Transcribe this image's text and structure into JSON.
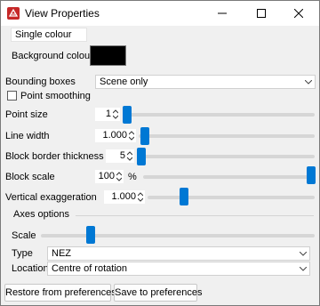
{
  "window": {
    "title": "View Properties"
  },
  "display": {
    "mode_label": "Single colour",
    "background_label": "Background colour",
    "background_color": "#000000"
  },
  "bounding_boxes": {
    "label": "Bounding boxes",
    "value": "Scene only"
  },
  "point_smoothing": {
    "label": "Point smoothing",
    "checked": false
  },
  "point_size": {
    "label": "Point size",
    "value": "1",
    "slider": 0.0
  },
  "line_width": {
    "label": "Line width",
    "value": "1.000",
    "slider": 0.05
  },
  "block_border": {
    "label": "Block border thickness",
    "value": "5",
    "slider": 0.0
  },
  "block_scale": {
    "label": "Block scale",
    "value": "100",
    "unit": "%",
    "slider": 1.0
  },
  "vertical_exaggeration": {
    "label": "Vertical exaggeration",
    "value": "1.000",
    "slider": 0.35
  },
  "axes": {
    "title": "Axes options",
    "scale_label": "Scale",
    "scale_slider": 0.15,
    "type_label": "Type",
    "type_value": "NEZ",
    "location_label": "Location",
    "location_value": "Centre of rotation"
  },
  "buttons": {
    "restore": "Restore from preferences",
    "save": "Save to preferences"
  },
  "colors": {
    "accent": "#0078d4",
    "app_icon": "#c62828"
  }
}
